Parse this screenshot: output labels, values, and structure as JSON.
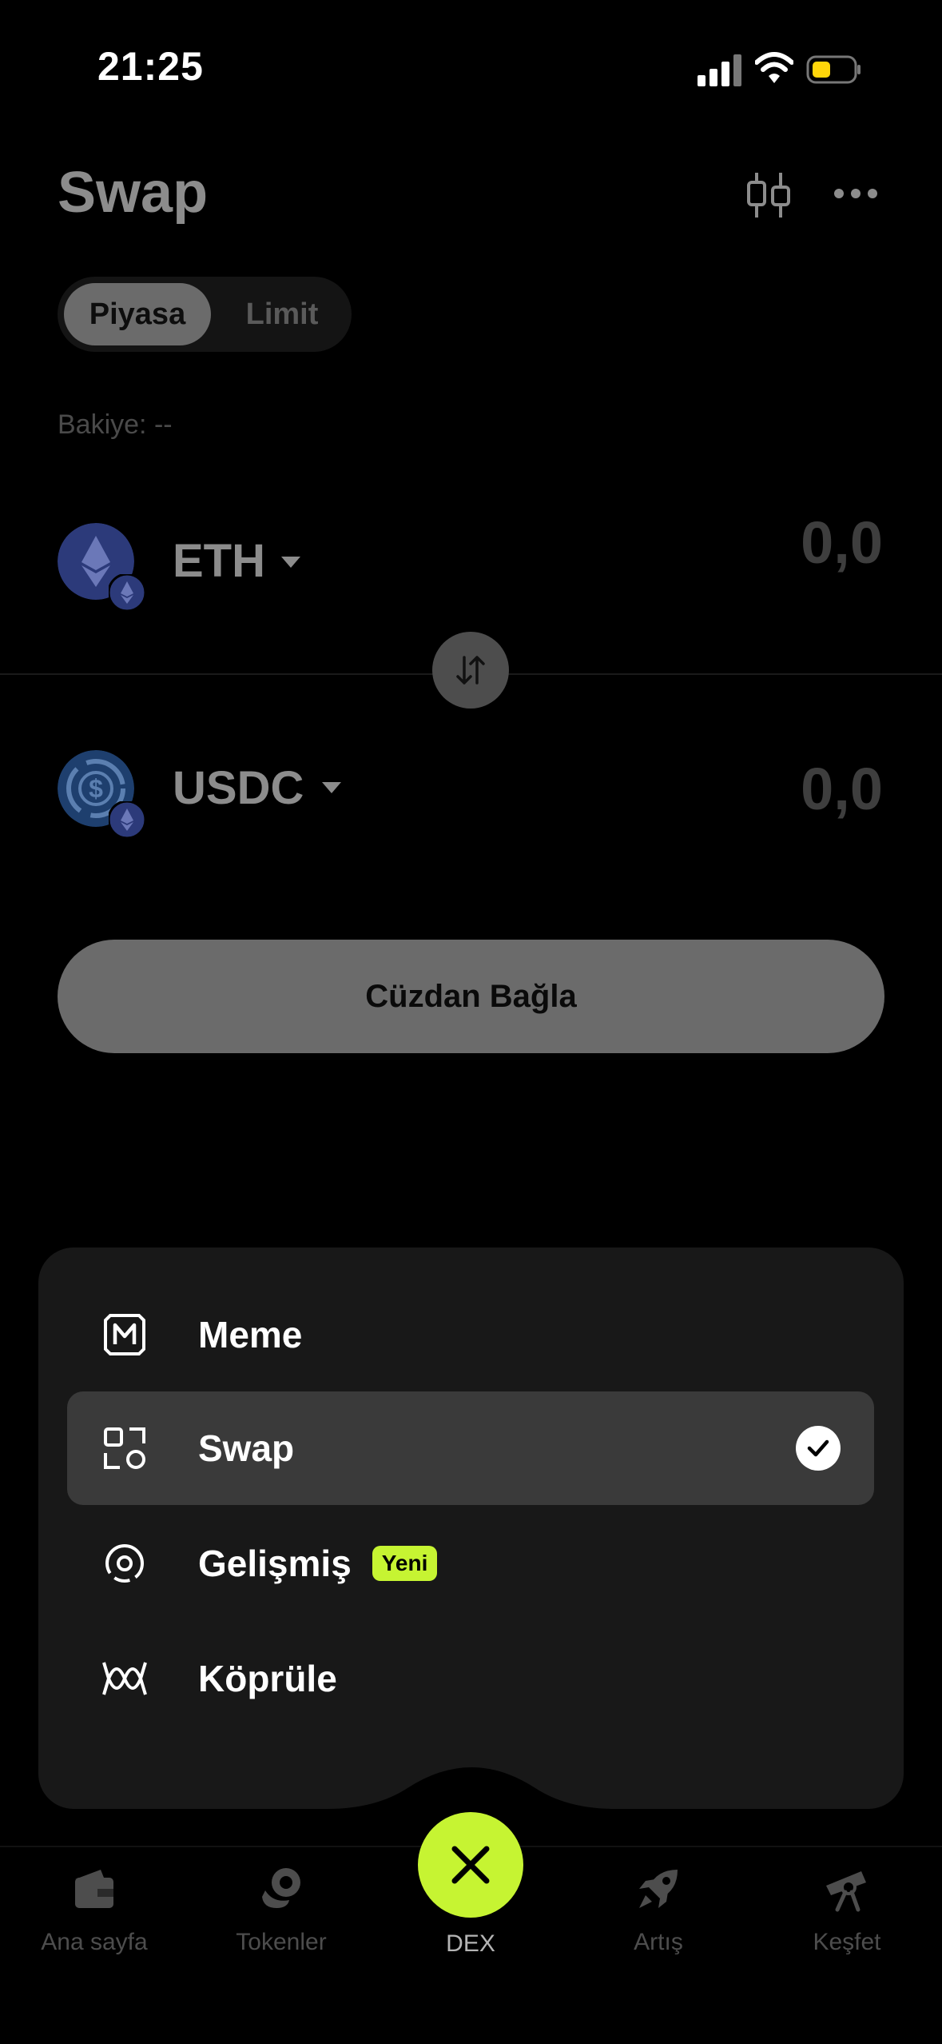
{
  "status_bar": {
    "time": "21:25",
    "battery_color": "#FFD60A"
  },
  "header": {
    "title": "Swap",
    "chart_icon": "candlestick-icon",
    "more_icon": "ellipsis-icon"
  },
  "mode_tabs": [
    {
      "label": "Piyasa",
      "selected": true
    },
    {
      "label": "Limit",
      "selected": false
    }
  ],
  "balance": "Bakiye: --",
  "from_token": {
    "symbol": "ETH",
    "amount": "0,0",
    "icon": "ethereum-icon"
  },
  "to_token": {
    "symbol": "USDC",
    "amount": "0,0",
    "icon": "usdc-icon"
  },
  "connect_button": "Cüzdan Bağla",
  "menu": {
    "items": [
      {
        "label": "Meme",
        "icon": "meme-icon",
        "active": false
      },
      {
        "label": "Swap",
        "icon": "swap-grid-icon",
        "active": true
      },
      {
        "label": "Gelişmiş",
        "icon": "advanced-icon",
        "active": false,
        "badge": "Yeni"
      },
      {
        "label": "Köprüle",
        "icon": "bridge-icon",
        "active": false
      }
    ]
  },
  "bottom_nav": {
    "items": [
      {
        "label": "Ana sayfa",
        "icon": "wallet-icon"
      },
      {
        "label": "Tokenler",
        "icon": "tokens-icon"
      },
      {
        "label": "DEX",
        "icon": "close-icon",
        "active": true
      },
      {
        "label": "Artış",
        "icon": "rocket-icon"
      },
      {
        "label": "Keşfet",
        "icon": "telescope-icon"
      }
    ]
  },
  "colors": {
    "accent": "#C6F432",
    "background": "#000000",
    "card": "#181818"
  }
}
